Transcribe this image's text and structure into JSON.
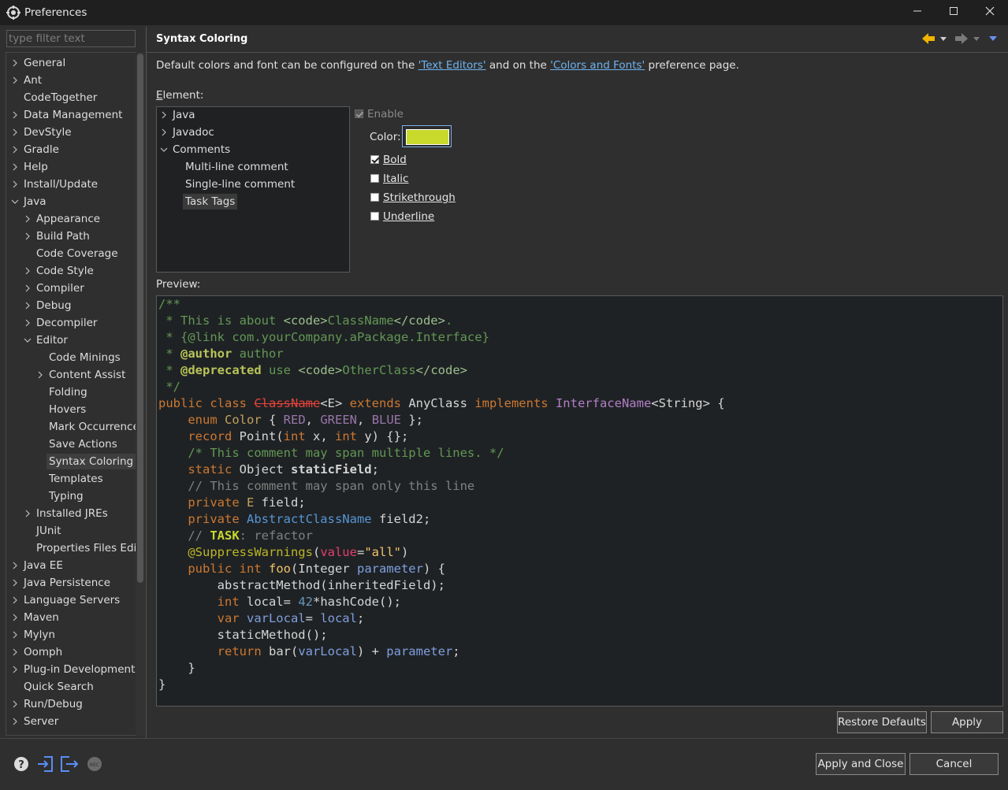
{
  "window": {
    "title": "Preferences",
    "minimize_label": "—",
    "maximize_label": "☐",
    "close_label": "✕"
  },
  "sidebar": {
    "filter_placeholder": "type filter text",
    "items": [
      {
        "label": "General",
        "level": 0,
        "expandable": true,
        "expanded": false
      },
      {
        "label": "Ant",
        "level": 0,
        "expandable": true,
        "expanded": false
      },
      {
        "label": "CodeTogether",
        "level": 0,
        "expandable": false
      },
      {
        "label": "Data Management",
        "level": 0,
        "expandable": true,
        "expanded": false
      },
      {
        "label": "DevStyle",
        "level": 0,
        "expandable": true,
        "expanded": false
      },
      {
        "label": "Gradle",
        "level": 0,
        "expandable": true,
        "expanded": false
      },
      {
        "label": "Help",
        "level": 0,
        "expandable": true,
        "expanded": false
      },
      {
        "label": "Install/Update",
        "level": 0,
        "expandable": true,
        "expanded": false
      },
      {
        "label": "Java",
        "level": 0,
        "expandable": true,
        "expanded": true
      },
      {
        "label": "Appearance",
        "level": 1,
        "expandable": true,
        "expanded": false
      },
      {
        "label": "Build Path",
        "level": 1,
        "expandable": true,
        "expanded": false
      },
      {
        "label": "Code Coverage",
        "level": 1,
        "expandable": false
      },
      {
        "label": "Code Style",
        "level": 1,
        "expandable": true,
        "expanded": false
      },
      {
        "label": "Compiler",
        "level": 1,
        "expandable": true,
        "expanded": false
      },
      {
        "label": "Debug",
        "level": 1,
        "expandable": true,
        "expanded": false
      },
      {
        "label": "Decompiler",
        "level": 1,
        "expandable": true,
        "expanded": false
      },
      {
        "label": "Editor",
        "level": 1,
        "expandable": true,
        "expanded": true
      },
      {
        "label": "Code Minings",
        "level": 2,
        "expandable": false
      },
      {
        "label": "Content Assist",
        "level": 2,
        "expandable": true,
        "expanded": false
      },
      {
        "label": "Folding",
        "level": 2,
        "expandable": false
      },
      {
        "label": "Hovers",
        "level": 2,
        "expandable": false
      },
      {
        "label": "Mark Occurrence",
        "level": 2,
        "expandable": false
      },
      {
        "label": "Save Actions",
        "level": 2,
        "expandable": false
      },
      {
        "label": "Syntax Coloring",
        "level": 2,
        "expandable": false,
        "selected": true
      },
      {
        "label": "Templates",
        "level": 2,
        "expandable": false
      },
      {
        "label": "Typing",
        "level": 2,
        "expandable": false
      },
      {
        "label": "Installed JREs",
        "level": 1,
        "expandable": true,
        "expanded": false
      },
      {
        "label": "JUnit",
        "level": 1,
        "expandable": false
      },
      {
        "label": "Properties Files Edito",
        "level": 1,
        "expandable": false
      },
      {
        "label": "Java EE",
        "level": 0,
        "expandable": true,
        "expanded": false
      },
      {
        "label": "Java Persistence",
        "level": 0,
        "expandable": true,
        "expanded": false
      },
      {
        "label": "Language Servers",
        "level": 0,
        "expandable": true,
        "expanded": false
      },
      {
        "label": "Maven",
        "level": 0,
        "expandable": true,
        "expanded": false
      },
      {
        "label": "Mylyn",
        "level": 0,
        "expandable": true,
        "expanded": false
      },
      {
        "label": "Oomph",
        "level": 0,
        "expandable": true,
        "expanded": false
      },
      {
        "label": "Plug-in Development",
        "level": 0,
        "expandable": true,
        "expanded": false
      },
      {
        "label": "Quick Search",
        "level": 0,
        "expandable": false
      },
      {
        "label": "Run/Debug",
        "level": 0,
        "expandable": true,
        "expanded": false
      },
      {
        "label": "Server",
        "level": 0,
        "expandable": true,
        "expanded": false
      }
    ]
  },
  "page": {
    "title": "Syntax Coloring",
    "desc_before": "Default colors and font can be configured on the ",
    "link1": "'Text Editors'",
    "desc_middle": " and on the ",
    "link2": "'Colors and Fonts'",
    "desc_after": " preference page.",
    "element_label": "Element:",
    "preview_label": "Preview:"
  },
  "element_tree": [
    {
      "label": "Java",
      "level": 0,
      "expandable": true,
      "expanded": false
    },
    {
      "label": "Javadoc",
      "level": 0,
      "expandable": true,
      "expanded": false
    },
    {
      "label": "Comments",
      "level": 0,
      "expandable": true,
      "expanded": true
    },
    {
      "label": "Multi-line comment",
      "level": 1,
      "expandable": false
    },
    {
      "label": "Single-line comment",
      "level": 1,
      "expandable": false
    },
    {
      "label": "Task Tags",
      "level": 1,
      "expandable": false,
      "selected": true
    }
  ],
  "options": {
    "enable_label": "Enable",
    "enable_checked": true,
    "color_label": "Color:",
    "color_value": "#c8d92c",
    "bold_label": "Bold",
    "bold_checked": true,
    "italic_label": "Italic",
    "italic_checked": false,
    "strike_label": "Strikethrough",
    "strike_checked": false,
    "underline_label": "Underline",
    "underline_checked": false
  },
  "colors": {
    "comment": "#629755",
    "javadoc_kw": "#b9c45a",
    "javadoc_tag": "#9cbf8e",
    "keyword": "#cc7832",
    "type": "#c3a15f",
    "text": "#d5d5d5",
    "enum_const": "#9876aa",
    "field": "#8fb8e3",
    "param": "#7f9fe0",
    "number": "#6897bb",
    "string": "#f0c26a",
    "annotation": "#bbb529",
    "annot_attr": "#e0416b",
    "strike_class": "#e4433c",
    "slc": "#808080",
    "task": "#c8d92c",
    "abstract_class": "#5596d5",
    "iface": "#b17fc8"
  },
  "preview_lines": [
    [
      [
        "/**",
        "comment"
      ]
    ],
    [
      [
        " * This is about ",
        "comment"
      ],
      [
        "<code>",
        "javadoc_tag"
      ],
      [
        "ClassName",
        "comment"
      ],
      [
        "</code>",
        "javadoc_tag"
      ],
      [
        ".",
        "comment"
      ]
    ],
    [
      [
        " * {@link com.yourCompany.aPackage.Interface}",
        "comment"
      ]
    ],
    [
      [
        " * ",
        "comment"
      ],
      [
        "@author",
        "javadoc_kw_b"
      ],
      [
        " author",
        "comment"
      ]
    ],
    [
      [
        " * ",
        "comment"
      ],
      [
        "@deprecated",
        "javadoc_kw_b"
      ],
      [
        " use ",
        "comment"
      ],
      [
        "<code>",
        "javadoc_tag"
      ],
      [
        "OtherClass",
        "comment"
      ],
      [
        "</code>",
        "javadoc_tag"
      ]
    ],
    [
      [
        " */",
        "comment"
      ]
    ],
    [
      [
        "public class ",
        "keyword"
      ],
      [
        "ClassName",
        "strike_class"
      ],
      [
        "<E> ",
        "text"
      ],
      [
        "extends ",
        "keyword"
      ],
      [
        "AnyClass ",
        "text"
      ],
      [
        "implements ",
        "keyword"
      ],
      [
        "InterfaceName",
        "iface"
      ],
      [
        "<String> {",
        "text"
      ]
    ],
    [
      [
        "    enum ",
        "keyword"
      ],
      [
        "Color ",
        "type"
      ],
      [
        "{ ",
        "text"
      ],
      [
        "RED",
        "enum_const"
      ],
      [
        ", ",
        "text"
      ],
      [
        "GREEN",
        "enum_const"
      ],
      [
        ", ",
        "text"
      ],
      [
        "BLUE",
        "enum_const"
      ],
      [
        " };",
        "text"
      ]
    ],
    [
      [
        "    record ",
        "keyword"
      ],
      [
        "Point(",
        "text"
      ],
      [
        "int ",
        "keyword"
      ],
      [
        "x, ",
        "text"
      ],
      [
        "int ",
        "keyword"
      ],
      [
        "y) {};",
        "text"
      ]
    ],
    [
      [
        "    /* This comment may span multiple lines. */",
        "comment"
      ]
    ],
    [
      [
        "    static ",
        "keyword"
      ],
      [
        "Object ",
        "text"
      ],
      [
        "staticField",
        "text_b"
      ],
      [
        ";",
        "text"
      ]
    ],
    [
      [
        "    // This comment may span only this line",
        "slc"
      ]
    ],
    [
      [
        "    private ",
        "keyword"
      ],
      [
        "E ",
        "type"
      ],
      [
        "field",
        "text"
      ],
      [
        ";",
        "text"
      ]
    ],
    [
      [
        "    private ",
        "keyword"
      ],
      [
        "AbstractClassName ",
        "abstract_class"
      ],
      [
        "field2",
        "text"
      ],
      [
        ";",
        "text"
      ]
    ],
    [
      [
        "    // ",
        "slc"
      ],
      [
        "TASK",
        "task_b"
      ],
      [
        ": refactor",
        "slc"
      ]
    ],
    [
      [
        "    @SuppressWarnings",
        "annotation"
      ],
      [
        "(",
        "text"
      ],
      [
        "value",
        "annot_attr"
      ],
      [
        "=",
        "text"
      ],
      [
        "\"all\"",
        "string"
      ],
      [
        ")",
        "text"
      ]
    ],
    [
      [
        "    public ",
        "keyword"
      ],
      [
        "int ",
        "keyword"
      ],
      [
        "foo",
        "string"
      ],
      [
        "(Integer ",
        "text"
      ],
      [
        "parameter",
        "param"
      ],
      [
        ") {",
        "text"
      ]
    ],
    [
      [
        "        abstractMethod(inheritedField);",
        "text"
      ]
    ],
    [
      [
        "        int ",
        "keyword"
      ],
      [
        "local",
        "text"
      ],
      [
        "= ",
        "text"
      ],
      [
        "42",
        "number"
      ],
      [
        "*hashCode();",
        "text"
      ]
    ],
    [
      [
        "        var ",
        "keyword"
      ],
      [
        "varLocal",
        "param"
      ],
      [
        "= ",
        "text"
      ],
      [
        "local",
        "param"
      ],
      [
        ";",
        "text"
      ]
    ],
    [
      [
        "        staticMethod();",
        "text"
      ]
    ],
    [
      [
        "        return ",
        "keyword"
      ],
      [
        "bar(",
        "text"
      ],
      [
        "varLocal",
        "param"
      ],
      [
        ") + ",
        "text"
      ],
      [
        "parameter",
        "param"
      ],
      [
        ";",
        "text"
      ]
    ],
    [
      [
        "    }",
        "text"
      ]
    ],
    [
      [
        "}",
        "text"
      ]
    ]
  ],
  "buttons": {
    "restore_defaults": "Restore Defaults",
    "apply": "Apply",
    "apply_and_close": "Apply and Close",
    "cancel": "Cancel"
  },
  "footer_icons": [
    "help-icon",
    "import-icon",
    "export-icon",
    "record-icon"
  ]
}
